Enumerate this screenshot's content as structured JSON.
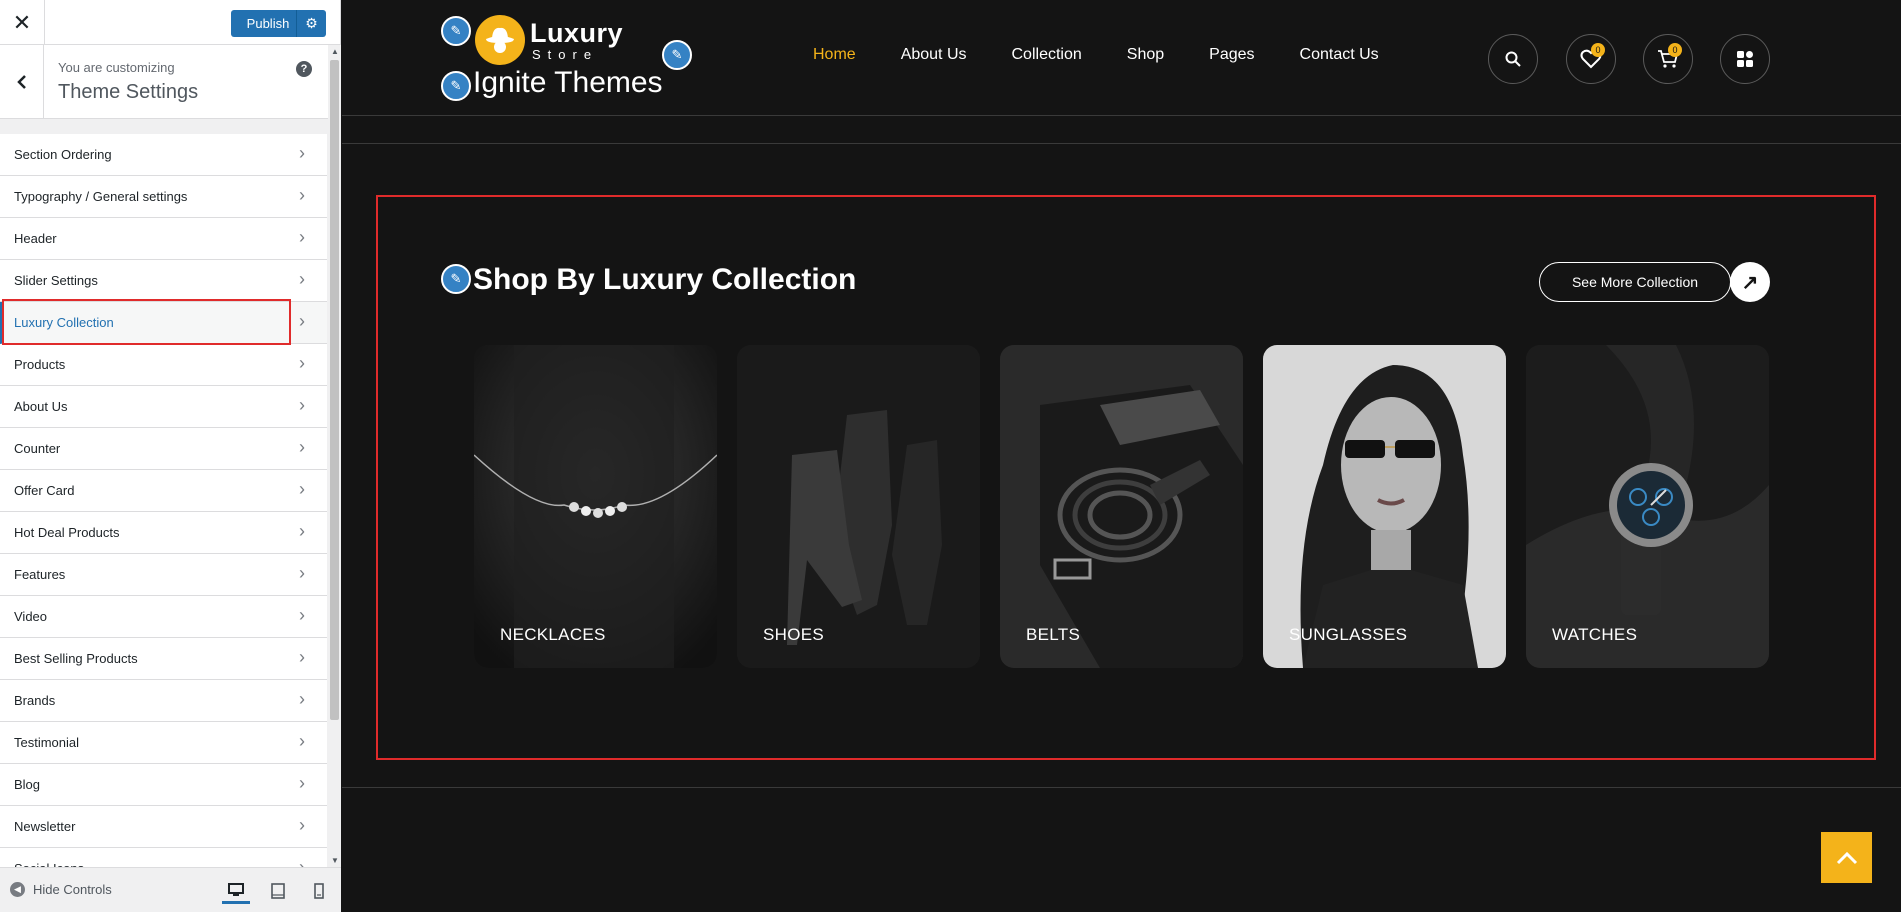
{
  "customizer": {
    "publish_label": "Publish",
    "you_are_customizing": "You are customizing",
    "panel_title": "Theme Settings",
    "hide_controls_label": "Hide Controls",
    "sections": [
      {
        "label": "Section Ordering"
      },
      {
        "label": "Typography / General settings"
      },
      {
        "label": "Header"
      },
      {
        "label": "Slider Settings"
      },
      {
        "label": "Luxury Collection",
        "active": true
      },
      {
        "label": "Products"
      },
      {
        "label": "About Us"
      },
      {
        "label": "Counter"
      },
      {
        "label": "Offer Card"
      },
      {
        "label": "Hot Deal Products"
      },
      {
        "label": "Features"
      },
      {
        "label": "Video"
      },
      {
        "label": "Best Selling Products"
      },
      {
        "label": "Brands"
      },
      {
        "label": "Testimonial"
      },
      {
        "label": "Blog"
      },
      {
        "label": "Newsletter"
      },
      {
        "label": "Social Icons"
      }
    ]
  },
  "site": {
    "logo_name": "Luxury",
    "logo_subtitle": "Store",
    "title": "Ignite Themes",
    "nav": [
      {
        "label": "Home",
        "current": true
      },
      {
        "label": "About Us"
      },
      {
        "label": "Collection"
      },
      {
        "label": "Shop"
      },
      {
        "label": "Pages"
      },
      {
        "label": "Contact Us"
      }
    ],
    "wishlist_count": "0",
    "cart_count": "0",
    "accent_color": "#f4b31a"
  },
  "collection": {
    "title": "Shop By Luxury Collection",
    "see_more_label": "See More Collection",
    "cards": [
      {
        "label": "NECKLACES"
      },
      {
        "label": "SHOES"
      },
      {
        "label": "BELTS"
      },
      {
        "label": "SUNGLASSES"
      },
      {
        "label": "WATCHES"
      }
    ]
  }
}
